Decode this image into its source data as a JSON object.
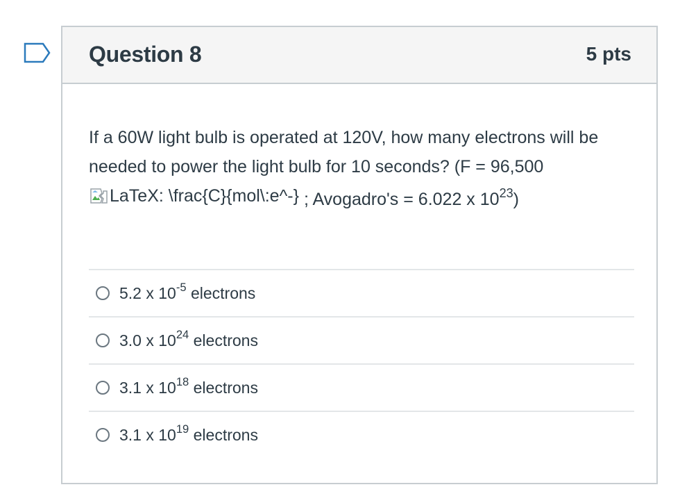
{
  "question": {
    "title": "Question 8",
    "points": "5 pts",
    "text_part1": "If a 60W light bulb is operated at 120V, how many electrons will be needed to power the light bulb for 10 seconds?  (F = 96,500 ",
    "image_alt": "LaTeX: \\frac{C}{mol\\:e^-}",
    "text_part2": " ;  Avogadro's = 6.022 x 10",
    "text_exp": "23",
    "text_part3": ")"
  },
  "answers": [
    {
      "base": "5.2 x 10",
      "exp": "-5",
      "unit": " electrons"
    },
    {
      "base": "3.0 x 10",
      "exp": "24",
      "unit": " electrons"
    },
    {
      "base": "3.1 x 10",
      "exp": "18",
      "unit": " electrons"
    },
    {
      "base": "3.1 x 10",
      "exp": "19",
      "unit": " electrons"
    }
  ],
  "icons": {
    "flag": "flag-outline-icon",
    "broken_image": "broken-image-icon",
    "radio": "radio-unchecked-icon"
  },
  "colors": {
    "text": "#2d3b45",
    "border": "#c7cdd1",
    "header_bg": "#f5f5f5",
    "flag": "#2b7abc"
  }
}
